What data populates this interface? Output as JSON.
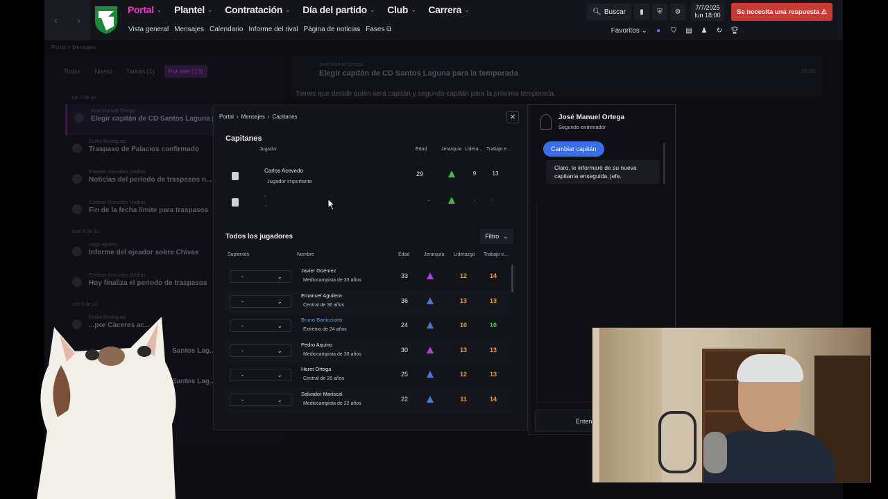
{
  "topnav": {
    "items": [
      {
        "label": "Portal",
        "active": true
      },
      {
        "label": "Plantel"
      },
      {
        "label": "Contratación"
      },
      {
        "label": "Día del partido"
      },
      {
        "label": "Club"
      },
      {
        "label": "Carrera"
      }
    ],
    "subnav": [
      "Vista general",
      "Mensajes",
      "Calendario",
      "Informe del rival",
      "Página de noticias",
      "Fases"
    ],
    "search_label": "Buscar",
    "date": "7/7/2025",
    "day_time": "lun  18:00",
    "alert_label": "Se necesita una respuesta",
    "favorites_label": "Favoritos",
    "accent_color": "#e63cc8",
    "alert_color": "#c93a32"
  },
  "background": {
    "breadcrumb": "Portal  >  Mensajes",
    "filters": [
      "Todos",
      "Nuevo",
      "Tareas (1)",
      "Por leer (13)"
    ],
    "messages": [
      {
        "date": "lun 7 de jul.",
        "from": "José Manuel Ortega",
        "subject": "Elegir capitán de CD Santos Laguna para...",
        "selected": true
      },
      {
        "from": "Emilio Rodríguez",
        "subject": "Traspaso de Palacios confirmado"
      },
      {
        "from": "Esteban González Lledías",
        "subject": "Noticias del periodo de traspasos n..."
      },
      {
        "from": "Esteban González Lledías",
        "subject": "Fin de la fecha límite para traspasos"
      },
      {
        "date": "dom 6 de jul.",
        "from": "Hugo Aguirre",
        "subject": "Informe del ojeador sobre Chivas"
      },
      {
        "from": "Esteban González Lledías",
        "subject": "Hoy finaliza el periodo de traspasos"
      },
      {
        "date": "sáb 5 de jul.",
        "from": "Emilio Rodríguez",
        "subject": "...por Cáceres ac..."
      },
      {
        "from": "",
        "subject": "Santos Lag..."
      },
      {
        "from": "",
        "subject": "Santos Lag..."
      }
    ],
    "reader": {
      "from": "José Manuel Ortega",
      "subject": "Elegir capitán de CD Santos Laguna para la temporada",
      "time": "06:00",
      "body": "Tienes que decidir quién será capitán y segundo capitán para la próxima temporada."
    }
  },
  "modal": {
    "breadcrumb": [
      "Portal",
      "Mensajes",
      "Capitanes"
    ],
    "captains_title": "Capitanes",
    "captains_headers": {
      "player": "Jugador",
      "age": "Edad",
      "hierarchy": "Jerarquía",
      "leadership": "Lidera...",
      "work": "Trabajo e..."
    },
    "captains": [
      {
        "name": "Carlos Acevedo",
        "role": "Jugador importante",
        "age": "29",
        "leadership": "9",
        "work": "13"
      },
      {
        "name": "-",
        "role": "-",
        "age": "-",
        "leadership": "-",
        "work": "-"
      }
    ],
    "all_title": "Todos los jugadores",
    "filter_label": "Filtro",
    "players_headers": {
      "sub": "Suplentes",
      "name": "Nombre",
      "age": "Edad",
      "hierarchy": "Jerarquía",
      "leadership": "Liderazgo",
      "work": "Trabajo e..."
    },
    "players": [
      {
        "select": "-",
        "name": "Javier Güémez",
        "role": "Mediocampista de 33 años",
        "age": "33",
        "hier": "purple",
        "lead": "12",
        "work": "14",
        "work_color": "orange"
      },
      {
        "select": "-",
        "name": "Emanuel Aguilera",
        "role": "Central de 36 años",
        "age": "36",
        "hier": "blue",
        "lead": "13",
        "work": "13",
        "work_color": "orange"
      },
      {
        "select": "-",
        "name": "Bruno Barticciotto",
        "role": "Extremo de 24 años",
        "age": "24",
        "hier": "blue",
        "lead": "10",
        "work": "16",
        "work_color": "green",
        "link": true
      },
      {
        "select": "-",
        "name": "Pedro Aquino",
        "role": "Mediocampista de 30 años",
        "age": "30",
        "hier": "purple",
        "lead": "13",
        "work": "13",
        "work_color": "orange"
      },
      {
        "select": "-",
        "name": "Haret Ortega",
        "role": "Central de 26 años",
        "age": "25",
        "hier": "blue",
        "lead": "12",
        "work": "13",
        "work_color": "orange"
      },
      {
        "select": "-",
        "name": "Salvador Mariscal",
        "role": "Mediocampista de 22 años",
        "age": "22",
        "hier": "blue",
        "lead": "11",
        "work": "14",
        "work_color": "orange"
      }
    ]
  },
  "chat": {
    "name": "José Manuel Ortega",
    "role": "Segundo entrenador",
    "action_label": "Cambiar capitán",
    "reply": "Claro, le informaré de su nueva capitanía enseguida, jefe.",
    "enter_label": "Entend..."
  }
}
